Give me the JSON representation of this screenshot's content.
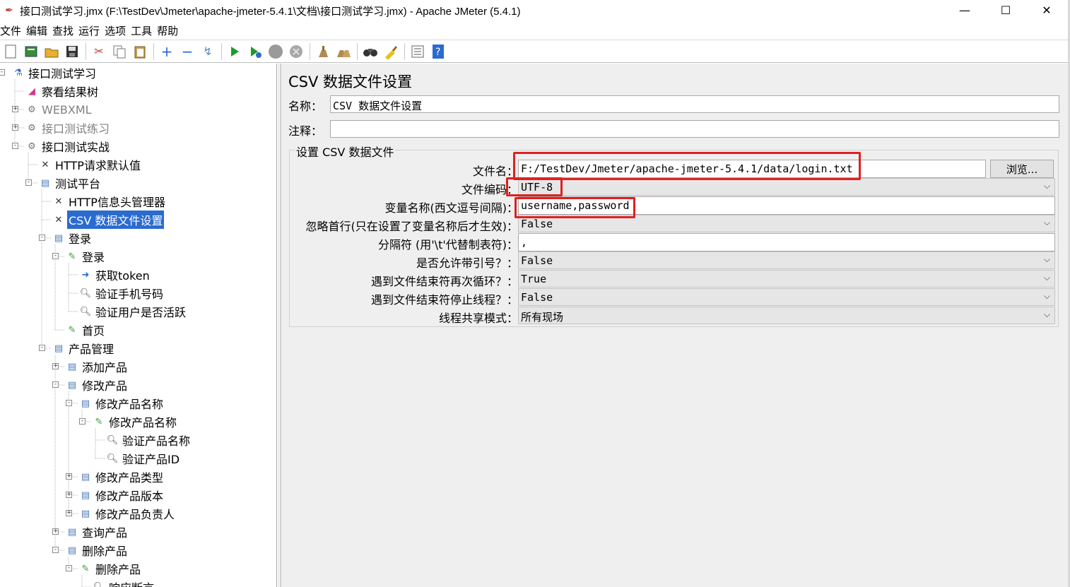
{
  "window": {
    "title": "接口测试学习.jmx (F:\\TestDev\\Jmeter\\apache-jmeter-5.4.1\\文档\\接口测试学习.jmx) - Apache JMeter (5.4.1)",
    "minimize": "—",
    "maximize": "☐",
    "close": "✕"
  },
  "menu": [
    "文件",
    "编辑",
    "查找",
    "运行",
    "选项",
    "工具",
    "帮助"
  ],
  "toolbar_icons": [
    "new-icon",
    "templates-icon",
    "open-icon",
    "save-icon",
    "cut-icon",
    "copy-icon",
    "paste-icon",
    "expand-icon",
    "collapse-icon",
    "toggle-icon",
    "start-icon",
    "start-no-pause-icon",
    "stop-icon",
    "shutdown-icon",
    "clear-icon",
    "clear-all-icon",
    "search-icon",
    "reset-search-icon",
    "function-helper-icon",
    "help-icon"
  ],
  "tree": [
    {
      "label": "接口测试学习",
      "icon": "test-plan-icon",
      "depth": 0,
      "expander": "-"
    },
    {
      "label": "察看结果树",
      "icon": "listener-icon",
      "depth": 1,
      "expander": ""
    },
    {
      "label": "WEBXML",
      "icon": "gear-icon",
      "depth": 1,
      "expander": "+",
      "disabled": true
    },
    {
      "label": "接口测试练习",
      "icon": "gear-icon",
      "depth": 1,
      "expander": "+",
      "disabled": true
    },
    {
      "label": "接口测试实战",
      "icon": "gear-icon",
      "depth": 1,
      "expander": "-"
    },
    {
      "label": "HTTP请求默认值",
      "icon": "tools-icon",
      "depth": 2,
      "expander": ""
    },
    {
      "label": "测试平台",
      "icon": "controller-icon",
      "depth": 2,
      "expander": "-"
    },
    {
      "label": "HTTP信息头管理器",
      "icon": "tools-icon",
      "depth": 3,
      "expander": ""
    },
    {
      "label": "CSV 数据文件设置",
      "icon": "tools-icon",
      "depth": 3,
      "expander": "",
      "selected": true
    },
    {
      "label": "登录",
      "icon": "controller-icon",
      "depth": 3,
      "expander": "-"
    },
    {
      "label": "登录",
      "icon": "sampler-icon",
      "depth": 4,
      "expander": "-"
    },
    {
      "label": "获取token",
      "icon": "preprocessor-icon",
      "depth": 5,
      "expander": ""
    },
    {
      "label": "验证手机号码",
      "icon": "assertion-icon",
      "depth": 5,
      "expander": ""
    },
    {
      "label": "验证用户是否活跃",
      "icon": "assertion-icon",
      "depth": 5,
      "expander": ""
    },
    {
      "label": "首页",
      "icon": "sampler-icon",
      "depth": 4,
      "expander": ""
    },
    {
      "label": "产品管理",
      "icon": "controller-icon",
      "depth": 3,
      "expander": "-"
    },
    {
      "label": "添加产品",
      "icon": "controller-icon",
      "depth": 4,
      "expander": "+"
    },
    {
      "label": "修改产品",
      "icon": "controller-icon",
      "depth": 4,
      "expander": "-"
    },
    {
      "label": "修改产品名称",
      "icon": "controller-icon",
      "depth": 5,
      "expander": "-"
    },
    {
      "label": "修改产品名称",
      "icon": "sampler-icon",
      "depth": 6,
      "expander": "-"
    },
    {
      "label": "验证产品名称",
      "icon": "assertion-icon",
      "depth": 7,
      "expander": ""
    },
    {
      "label": "验证产品ID",
      "icon": "assertion-icon",
      "depth": 7,
      "expander": ""
    },
    {
      "label": "修改产品类型",
      "icon": "controller-icon",
      "depth": 5,
      "expander": "+"
    },
    {
      "label": "修改产品版本",
      "icon": "controller-icon",
      "depth": 5,
      "expander": "+"
    },
    {
      "label": "修改产品负责人",
      "icon": "controller-icon",
      "depth": 5,
      "expander": "+"
    },
    {
      "label": "查询产品",
      "icon": "controller-icon",
      "depth": 4,
      "expander": "+"
    },
    {
      "label": "删除产品",
      "icon": "controller-icon",
      "depth": 4,
      "expander": "-"
    },
    {
      "label": "删除产品",
      "icon": "sampler-icon",
      "depth": 5,
      "expander": "-"
    },
    {
      "label": "响应断言",
      "icon": "assertion-icon",
      "depth": 6,
      "expander": ""
    }
  ],
  "panel": {
    "title": "CSV 数据文件设置",
    "name_label": "名称：",
    "name_value": "CSV 数据文件设置",
    "comment_label": "注释：",
    "comment_value": "",
    "group_title": "设置 CSV 数据文件",
    "browse_label": "浏览...",
    "fields": [
      {
        "label": "文件名：",
        "value": "F:/TestDev/Jmeter/apache-jmeter-5.4.1/data/login.txt",
        "kind": "text",
        "short": true
      },
      {
        "label": "文件编码：",
        "value": "UTF-8",
        "kind": "combo"
      },
      {
        "label": "变量名称(西文逗号间隔)：",
        "value": "username,password",
        "kind": "text"
      },
      {
        "label": "忽略首行(只在设置了变量名称后才生效)：",
        "value": "False",
        "kind": "combo"
      },
      {
        "label": "分隔符 (用'\\t'代替制表符)：",
        "value": ",",
        "kind": "text"
      },
      {
        "label": "是否允许带引号？：",
        "value": "False",
        "kind": "combo"
      },
      {
        "label": "遇到文件结束符再次循环？：",
        "value": "True",
        "kind": "combo"
      },
      {
        "label": "遇到文件结束符停止线程？：",
        "value": "False",
        "kind": "combo"
      },
      {
        "label": "线程共享模式：",
        "value": "所有现场",
        "kind": "combo"
      }
    ]
  },
  "colors": {
    "selection": "#2a6bd0",
    "highlight": "#e02020",
    "panel_bg": "#efefef"
  }
}
